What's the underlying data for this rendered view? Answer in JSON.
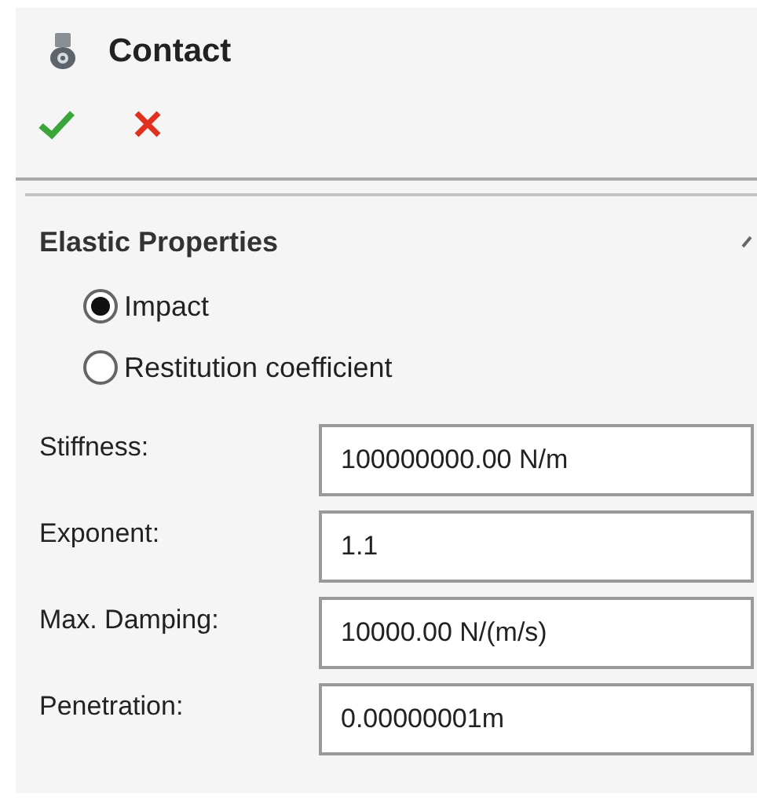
{
  "header": {
    "title": "Contact"
  },
  "section": {
    "title": "Elastic Properties",
    "expanded": true,
    "options": [
      {
        "label": "Impact",
        "selected": true
      },
      {
        "label": "Restitution coefficient",
        "selected": false
      }
    ],
    "fields": [
      {
        "label": "Stiffness:",
        "value": "100000000.00 N/m"
      },
      {
        "label": "Exponent:",
        "value": "1.1"
      },
      {
        "label": "Max. Damping:",
        "value": "10000.00 N/(m/s)"
      },
      {
        "label": "Penetration:",
        "value": "0.00000001m"
      }
    ]
  }
}
